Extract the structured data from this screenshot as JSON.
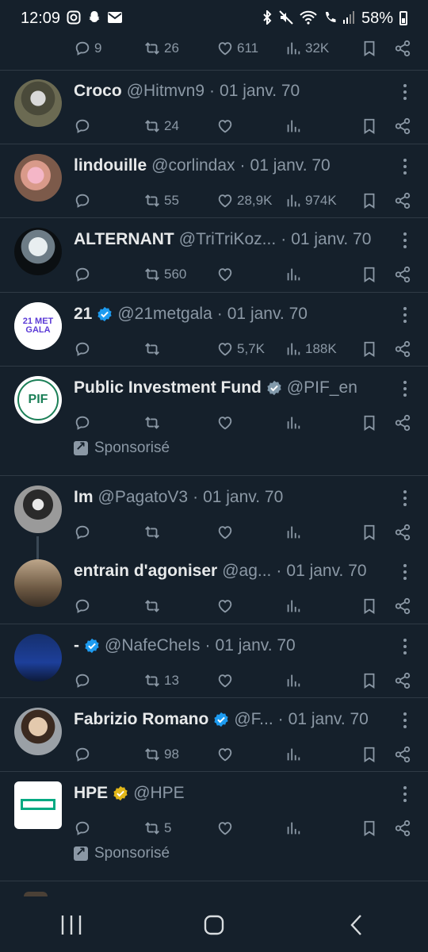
{
  "status_bar": {
    "time": "12:09",
    "battery": "58%",
    "left_icons": [
      "instagram-icon",
      "snapchat-icon",
      "mail-icon"
    ],
    "right_icons": [
      "bluetooth-icon",
      "mute-icon",
      "wifi-call-icon",
      "call-icon",
      "signal-icon"
    ]
  },
  "top_actions": {
    "replies": "9",
    "retweets": "26",
    "likes": "611",
    "views": "32K"
  },
  "tweets": [
    {
      "name": "Croco",
      "handle": "@Hitmvn9",
      "date": "01 janv. 70",
      "verified": "",
      "replies": "",
      "retweets": "24",
      "likes": "",
      "views": "",
      "sponsored": ""
    },
    {
      "name": "lindouille",
      "handle": "@corlindax",
      "date": "01 janv. 70",
      "verified": "",
      "replies": "",
      "retweets": "55",
      "likes": "28,9K",
      "views": "974K",
      "sponsored": ""
    },
    {
      "name": "ALTERNANT",
      "handle": "@TriTriKoz...",
      "date": "01 janv. 70",
      "verified": "",
      "replies": "",
      "retweets": "560",
      "likes": "",
      "views": "",
      "sponsored": ""
    },
    {
      "name": "21",
      "handle": "@21metgala",
      "date": "01 janv. 70",
      "verified": "blue",
      "replies": "",
      "retweets": "",
      "likes": "5,7K",
      "views": "188K",
      "sponsored": "",
      "avatar_text": "21 MET GALA"
    },
    {
      "name": "Public Investment Fund",
      "handle": "@PIF_en",
      "date": "",
      "verified": "grey",
      "replies": "",
      "retweets": "",
      "likes": "",
      "views": "",
      "sponsored": "Sponsorisé",
      "avatar_text": "PIF"
    },
    {
      "name": "Im",
      "handle": "@PagatoV3",
      "date": "01 janv. 70",
      "verified": "",
      "replies": "",
      "retweets": "",
      "likes": "",
      "views": "",
      "sponsored": ""
    },
    {
      "name": "entrain d'agoniser",
      "handle": "@ag...",
      "date": "01 janv. 70",
      "verified": "",
      "replies": "",
      "retweets": "",
      "likes": "",
      "views": "",
      "sponsored": ""
    },
    {
      "name": "-",
      "handle": "@NafeCheIs",
      "date": "01 janv. 70",
      "verified": "blue",
      "replies": "",
      "retweets": "13",
      "likes": "",
      "views": "",
      "sponsored": ""
    },
    {
      "name": "Fabrizio Romano",
      "handle": "@F...",
      "date": "01 janv. 70",
      "verified": "blue",
      "replies": "",
      "retweets": "98",
      "likes": "",
      "views": "",
      "sponsored": ""
    },
    {
      "name": "HPE",
      "handle": "@HPE",
      "date": "",
      "verified": "gold",
      "replies": "",
      "retweets": "5",
      "likes": "",
      "views": "",
      "sponsored": "Sponsorisé"
    }
  ],
  "colors": {
    "background": "#15202b",
    "text": "#e7e9ea",
    "muted": "#8b98a5",
    "verified_blue": "#1d9bf0",
    "verified_gold": "#e2b719",
    "verified_grey": "#829aab"
  },
  "nav": {
    "icons": [
      "recent-apps-icon",
      "home-icon",
      "back-icon"
    ]
  }
}
